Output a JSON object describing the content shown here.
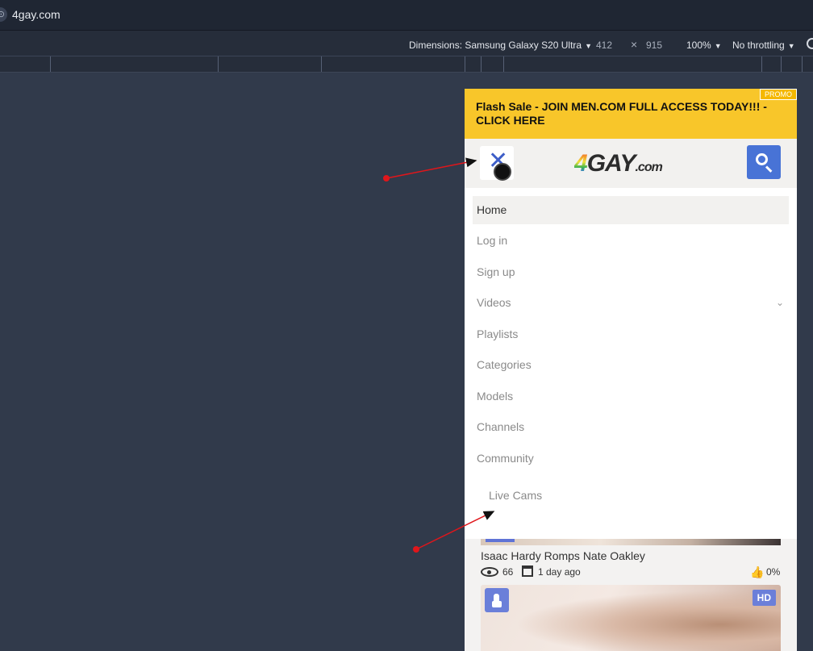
{
  "browser": {
    "address": "4gay.com"
  },
  "device_toolbar": {
    "dimensions_label": "Dimensions: Samsung Galaxy S20 Ultra",
    "width": "412",
    "times": "×",
    "height": "915",
    "zoom": "100%",
    "throttling": "No throttling"
  },
  "page": {
    "promo_text": "Flash Sale - JOIN MEN.COM FULL ACCESS TODAY!!! - CLICK HERE",
    "promo_tag": "PROMO",
    "logo_number": "4",
    "logo_text": "GAY",
    "logo_suffix": ".com",
    "menu": [
      {
        "label": "Home"
      },
      {
        "label": "Log in"
      },
      {
        "label": "Sign up"
      },
      {
        "label": "Videos"
      },
      {
        "label": "Playlists"
      },
      {
        "label": "Categories"
      },
      {
        "label": "Models"
      },
      {
        "label": "Channels"
      },
      {
        "label": "Community"
      }
    ],
    "live_cams": "Live Cams",
    "video": {
      "title": "Isaac Hardy Romps Nate Oakley",
      "views": "66",
      "date": "1 day ago",
      "likes": "0%"
    },
    "hd_badge": "HD"
  },
  "colors": {
    "promo_bg": "#f8c62a",
    "accent_blue": "#4873d6",
    "annotation_red": "#e0161b"
  }
}
